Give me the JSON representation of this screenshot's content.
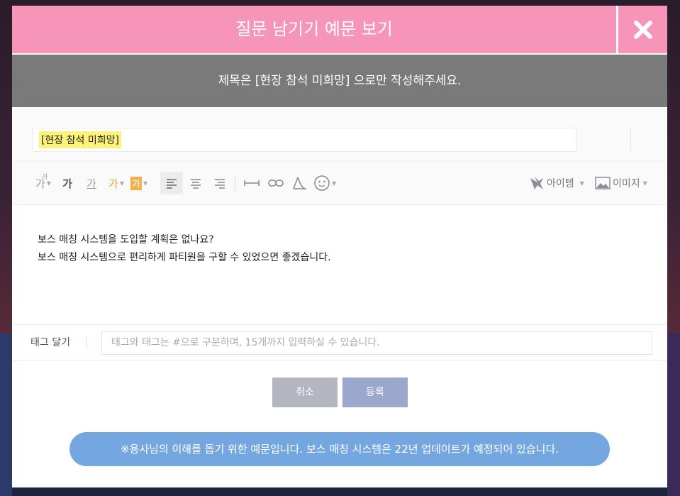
{
  "header": {
    "title": "질문 남기기 예문 보기"
  },
  "notice": {
    "text": "제목은 [현장 참석 미희망] 으로만 작성해주세요."
  },
  "title_field": {
    "value": "[현장 참석 미희망]"
  },
  "toolbar": {
    "font_size_glyph": "가",
    "font_size_super": "가",
    "bold_glyph": "가",
    "underline_glyph": "가",
    "font_color_glyph": "가",
    "bg_color_glyph": "가",
    "item_label": "아이템",
    "image_label": "이미지",
    "icons": [
      "font-size-icon",
      "bold-icon",
      "underline-icon",
      "font-color-icon",
      "background-color-icon",
      "align-left-icon",
      "align-center-icon",
      "align-right-icon",
      "horizontal-rule-icon",
      "link-icon",
      "map-pin-icon",
      "emoji-icon",
      "item-icon",
      "image-icon"
    ]
  },
  "editor": {
    "lines": [
      "보스 매칭 시스템을 도입할 계획은 없나요?",
      "보스 매칭 시스템으로 편리하게 파티원을 구할 수 있었으면 좋겠습니다."
    ]
  },
  "tags": {
    "label": "태그 달기",
    "placeholder": "태그와 태그는 #으로 구분하며, 15개까지 입력하실 수 있습니다."
  },
  "buttons": {
    "cancel": "취소",
    "submit": "등록"
  },
  "info": {
    "text": "※용사님의 이해를 돕기 위한 예문입니다. 보스 매칭 시스템은 22년 업데이트가 예정되어 있습니다."
  },
  "colors": {
    "header": "#f795b8",
    "notice_bar": "#7a7a7a",
    "highlight": "#fff27a",
    "info_pill": "#74a6e0",
    "cancel_button": "#b3b6bf",
    "submit_button": "#9aa8cc",
    "font_color": "#f0a030"
  }
}
